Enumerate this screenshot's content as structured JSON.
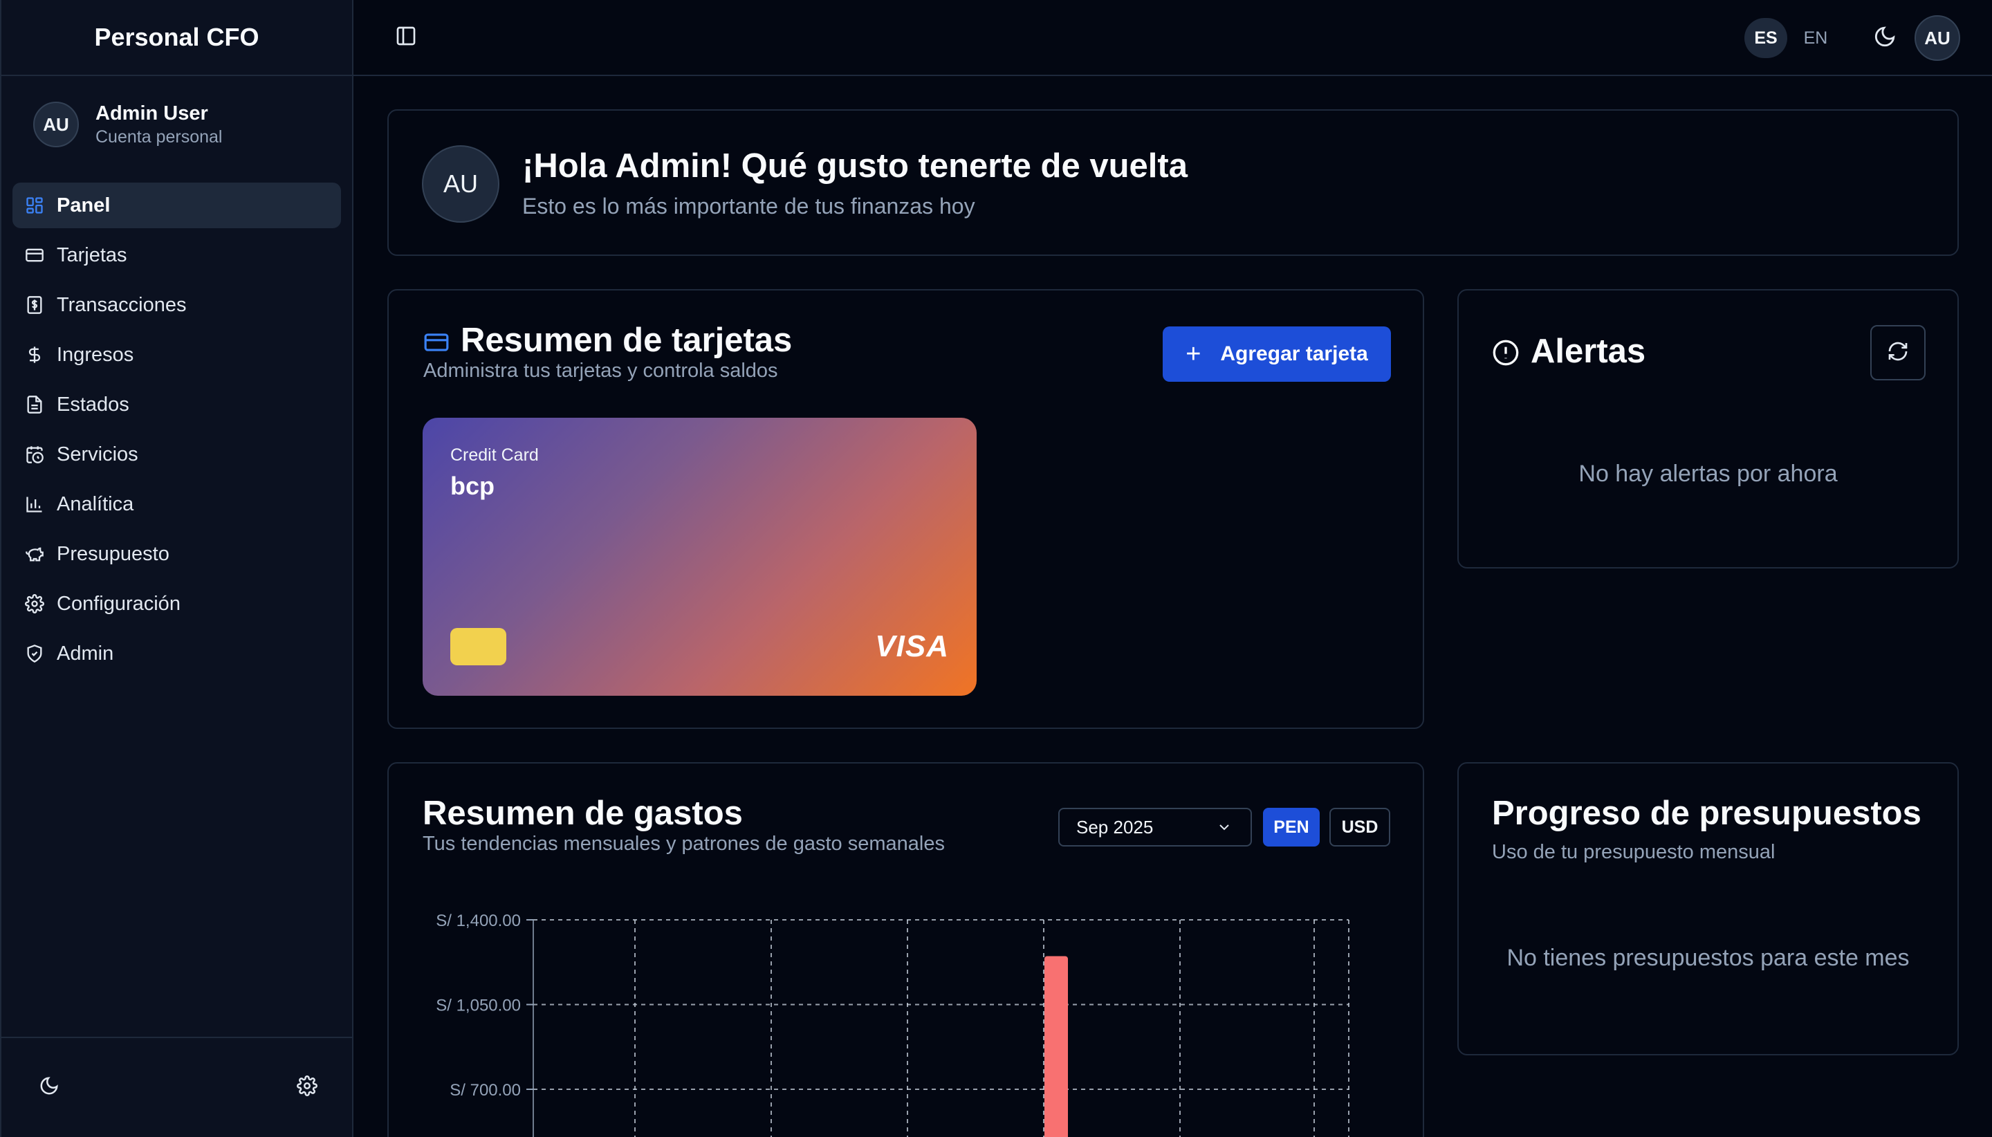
{
  "app": {
    "title": "Personal CFO"
  },
  "user": {
    "initials": "AU",
    "name": "Admin User",
    "account_type": "Cuenta personal"
  },
  "sidebar": {
    "items": [
      {
        "label": "Panel",
        "icon": "dashboard-icon",
        "active": true
      },
      {
        "label": "Tarjetas",
        "icon": "credit-card-icon"
      },
      {
        "label": "Transacciones",
        "icon": "receipt-icon"
      },
      {
        "label": "Ingresos",
        "icon": "dollar-icon"
      },
      {
        "label": "Estados",
        "icon": "file-text-icon"
      },
      {
        "label": "Servicios",
        "icon": "calendar-clock-icon"
      },
      {
        "label": "Analítica",
        "icon": "bar-chart-icon"
      },
      {
        "label": "Presupuesto",
        "icon": "piggy-bank-icon"
      },
      {
        "label": "Configuración",
        "icon": "gear-icon"
      },
      {
        "label": "Admin",
        "icon": "shield-icon"
      }
    ],
    "footer": {
      "theme_icon": "moon-icon",
      "settings_icon": "gear-icon"
    }
  },
  "topbar": {
    "languages": [
      "ES",
      "EN"
    ],
    "active_language": "ES",
    "avatar": "AU"
  },
  "welcome": {
    "avatar": "AU",
    "title": "¡Hola Admin! Qué gusto tenerte de vuelta",
    "subtitle": "Esto es lo más importante de tus finanzas hoy"
  },
  "cards_summary": {
    "title": "Resumen de tarjetas",
    "subtitle": "Administra tus tarjetas y controla saldos",
    "add_button": "Agregar tarjeta",
    "card": {
      "type": "Credit Card",
      "bank": "bcp",
      "brand": "VISA"
    }
  },
  "alerts": {
    "title": "Alertas",
    "empty": "No hay alertas por ahora"
  },
  "spending": {
    "title": "Resumen de gastos",
    "subtitle": "Tus tendencias mensuales y patrones de gasto semanales",
    "month": "Sep 2025",
    "currencies": [
      "PEN",
      "USD"
    ],
    "active_currency": "PEN"
  },
  "budget": {
    "title": "Progreso de presupuestos",
    "subtitle": "Uso de tu presupuesto mensual",
    "empty": "No tienes presupuestos para este mes"
  },
  "colors": {
    "accent": "#1d4ed8",
    "bar": "#f87171",
    "background": "#030712"
  },
  "chart_data": {
    "type": "bar",
    "yticks": [
      "S/ 1,400.00",
      "S/ 1,050.00",
      "S/ 700.00"
    ],
    "ytick_values": [
      1400,
      1050,
      700
    ],
    "ylim": [
      0,
      1400
    ],
    "bars": [
      {
        "category_index": 4,
        "value": 1250
      }
    ],
    "category_count": 6,
    "grid": true
  }
}
